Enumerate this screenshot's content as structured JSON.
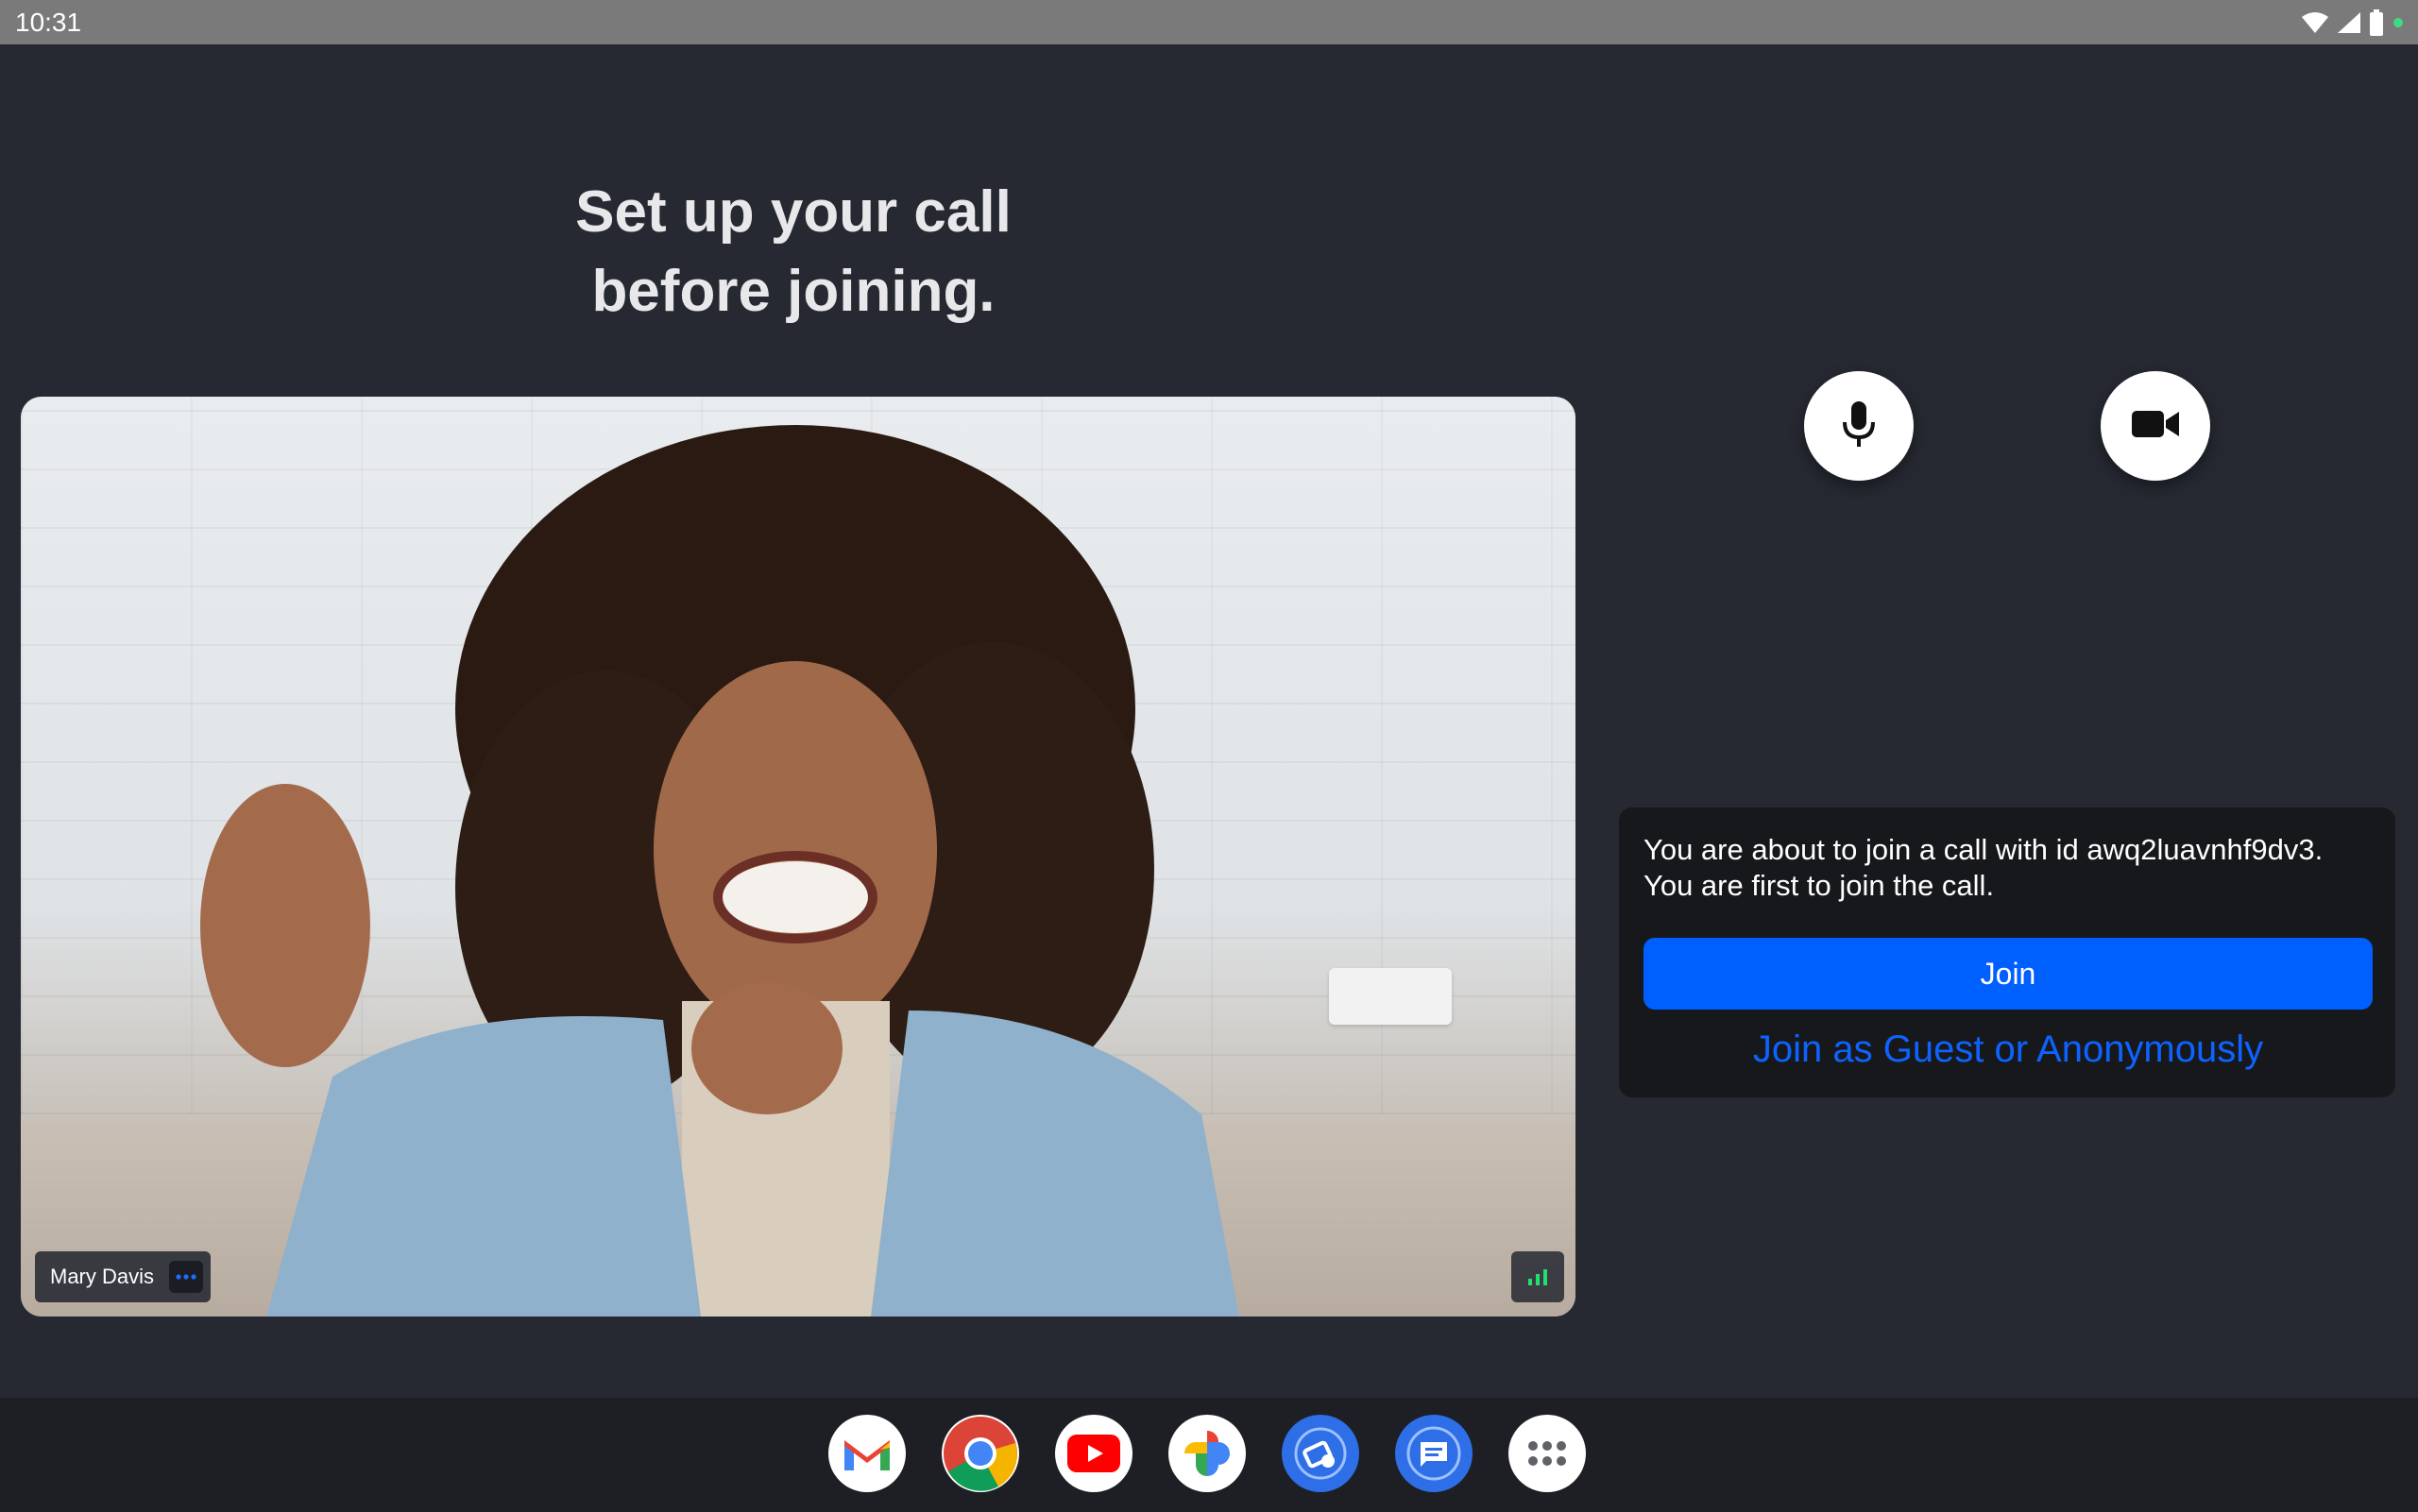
{
  "status_bar": {
    "time": "10:31",
    "icons": [
      "wifi-icon",
      "cell-signal-icon",
      "battery-icon",
      "dot-indicator-icon"
    ]
  },
  "setup": {
    "title_line1": "Set up your call",
    "title_line2": "before joining."
  },
  "video": {
    "participant_name": "Mary Davis",
    "more_icon": "more-dots-icon",
    "network_icon": "network-quality-icon"
  },
  "controls": {
    "mic_icon": "microphone-icon",
    "camera_icon": "video-camera-icon"
  },
  "join_card": {
    "message_line1": "You are about to join a call with id awq2luavnhf9dv3.",
    "message_line2": "You are first to join the call.",
    "join_label": "Join",
    "guest_label": "Join as Guest or Anonymously"
  },
  "dock": {
    "apps": [
      "gmail-icon",
      "chrome-icon",
      "youtube-icon",
      "photos-icon",
      "app-icon",
      "messages-icon",
      "app-drawer-icon"
    ]
  },
  "colors": {
    "background": "#262932",
    "accent_blue": "#005fff",
    "link_blue": "#0d63ff",
    "card": "#17181c"
  }
}
